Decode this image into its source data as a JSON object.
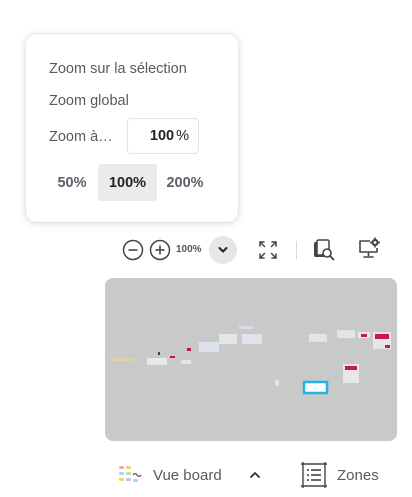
{
  "zoom_menu": {
    "zoom_to_selection": "Zoom sur la sélection",
    "zoom_global": "Zoom global",
    "zoom_to_label": "Zoom à…",
    "zoom_input_value": "100",
    "zoom_input_unit": "%",
    "presets": [
      {
        "label": "50%",
        "active": false
      },
      {
        "label": "100%",
        "active": true
      },
      {
        "label": "200%",
        "active": false
      }
    ]
  },
  "toolbar": {
    "zoom_level": "100%",
    "icons": {
      "zoom_out": "minus-circle-icon",
      "zoom_in": "plus-circle-icon",
      "dropdown": "chevron-down-icon",
      "fit": "fit-screen-icon",
      "search": "search-documents-icon",
      "present": "present-settings-icon"
    }
  },
  "minimap": {
    "background_color": "#c9c9c9",
    "viewport_color": "#1fb4e8"
  },
  "bottom_bar": {
    "board_view_label": "Vue board",
    "zones_label": "Zones"
  }
}
